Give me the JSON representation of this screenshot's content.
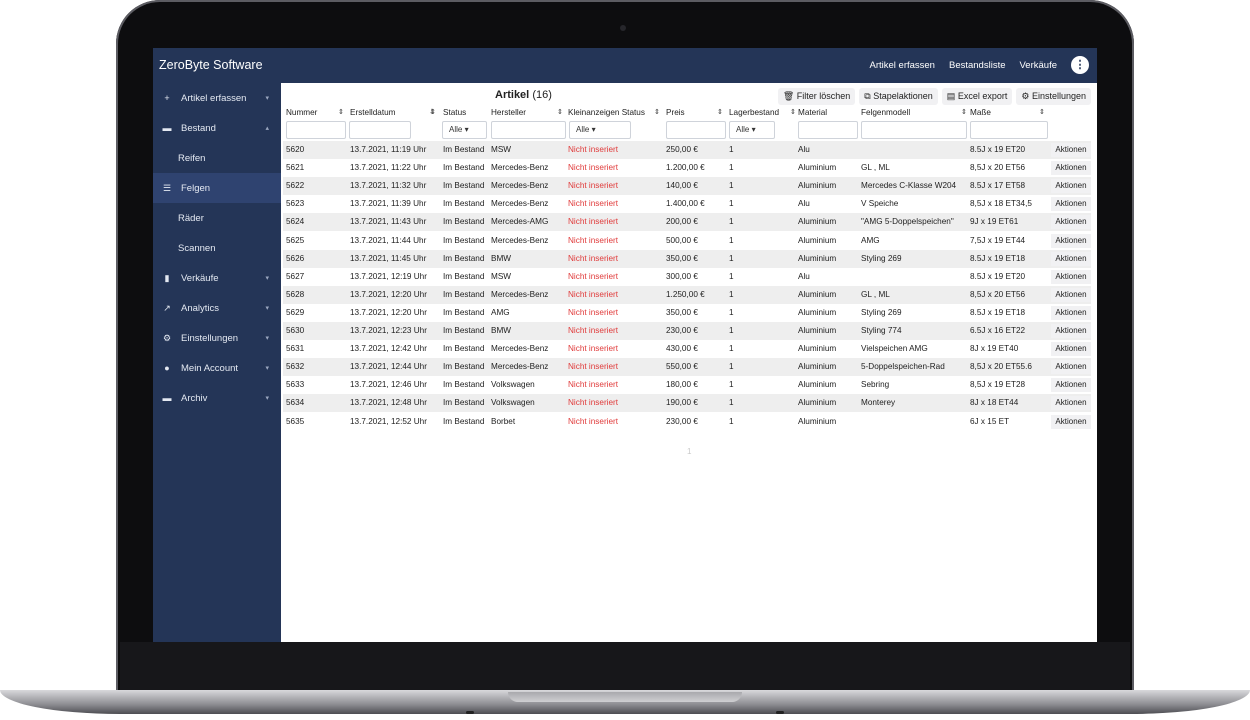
{
  "app": {
    "title": "ZeroByte Software"
  },
  "topnav": {
    "items": [
      "Artikel erfassen",
      "Bestandsliste",
      "Verkäufe"
    ],
    "menu_icon": "more-vertical-icon"
  },
  "sidebar": {
    "items": [
      {
        "label": "Artikel erfassen",
        "icon": "plus-icon"
      },
      {
        "label": "Bestand",
        "icon": "archive-icon"
      },
      {
        "label": "Reifen"
      },
      {
        "label": "Felgen",
        "icon": "list-icon",
        "active": true
      },
      {
        "label": "Räder"
      },
      {
        "label": "Scannen"
      },
      {
        "label": "Verkäufe",
        "icon": "document-icon"
      },
      {
        "label": "Analytics",
        "icon": "chart-icon"
      },
      {
        "label": "Einstellungen",
        "icon": "gears-icon"
      },
      {
        "label": "Mein Account",
        "icon": "user-icon"
      },
      {
        "label": "Archiv",
        "icon": "archive-box-icon"
      }
    ]
  },
  "main": {
    "title": "Artikel",
    "count": "(16)",
    "toolbar": [
      "Filter löschen",
      "Stapelaktionen",
      "Excel export",
      "Einstellungen"
    ],
    "columns": [
      "Nummer",
      "Erstelldatum",
      "Status",
      "Hersteller",
      "Kleinanzeigen Status",
      "Preis",
      "Lagerbestand",
      "Material",
      "Felgenmodell",
      "Maße"
    ],
    "filter_select_label": "Alle",
    "action_label": "Aktionen",
    "pagination": "1",
    "rows": [
      [
        "5620",
        "13.7.2021, 11:19 Uhr",
        "Im Bestand",
        "MSW",
        "Nicht inseriert",
        "250,00 €",
        "1",
        "Alu",
        "",
        "8.5J x 19 ET20"
      ],
      [
        "5621",
        "13.7.2021, 11:22 Uhr",
        "Im Bestand",
        "Mercedes-Benz",
        "Nicht inseriert",
        "1.200,00 €",
        "1",
        "Aluminium",
        "GL , ML",
        "8,5J x 20 ET56"
      ],
      [
        "5622",
        "13.7.2021, 11:32 Uhr",
        "Im Bestand",
        "Mercedes-Benz",
        "Nicht inseriert",
        "140,00 €",
        "1",
        "Aluminium",
        "Mercedes C-Klasse W204",
        "8.5J x 17 ET58"
      ],
      [
        "5623",
        "13.7.2021, 11:39 Uhr",
        "Im Bestand",
        "Mercedes-Benz",
        "Nicht inseriert",
        "1.400,00 €",
        "1",
        "Alu",
        "V Speiche",
        "8,5J x 18 ET34,5"
      ],
      [
        "5624",
        "13.7.2021, 11:43 Uhr",
        "Im Bestand",
        "Mercedes-AMG",
        "Nicht inseriert",
        "200,00 €",
        "1",
        "Aluminium",
        "\"AMG 5-Doppelspeichen\"",
        "9J x 19 ET61"
      ],
      [
        "5625",
        "13.7.2021, 11:44 Uhr",
        "Im Bestand",
        "Mercedes-Benz",
        "Nicht inseriert",
        "500,00 €",
        "1",
        "Aluminium",
        "AMG",
        "7,5J x 19 ET44"
      ],
      [
        "5626",
        "13.7.2021, 11:45 Uhr",
        "Im Bestand",
        "BMW",
        "Nicht inseriert",
        "350,00 €",
        "1",
        "Aluminium",
        "Styling 269",
        "8.5J x 19 ET18"
      ],
      [
        "5627",
        "13.7.2021, 12:19 Uhr",
        "Im Bestand",
        "MSW",
        "Nicht inseriert",
        "300,00 €",
        "1",
        "Alu",
        "",
        "8.5J x 19 ET20"
      ],
      [
        "5628",
        "13.7.2021, 12:20 Uhr",
        "Im Bestand",
        "Mercedes-Benz",
        "Nicht inseriert",
        "1.250,00 €",
        "1",
        "Aluminium",
        "GL , ML",
        "8,5J x 20 ET56"
      ],
      [
        "5629",
        "13.7.2021, 12:20 Uhr",
        "Im Bestand",
        "AMG",
        "Nicht inseriert",
        "350,00 €",
        "1",
        "Aluminium",
        "Styling 269",
        "8.5J x 19 ET18"
      ],
      [
        "5630",
        "13.7.2021, 12:23 Uhr",
        "Im Bestand",
        "BMW",
        "Nicht inseriert",
        "230,00 €",
        "1",
        "Aluminium",
        "Styling 774",
        "6.5J x 16 ET22"
      ],
      [
        "5631",
        "13.7.2021, 12:42 Uhr",
        "Im Bestand",
        "Mercedes-Benz",
        "Nicht inseriert",
        "430,00 €",
        "1",
        "Aluminium",
        "Vielspeichen AMG",
        "8J x 19 ET40"
      ],
      [
        "5632",
        "13.7.2021, 12:44 Uhr",
        "Im Bestand",
        "Mercedes-Benz",
        "Nicht inseriert",
        "550,00 €",
        "1",
        "Aluminium",
        "5-Doppelspeichen-Rad",
        "8,5J x 20 ET55.6"
      ],
      [
        "5633",
        "13.7.2021, 12:46 Uhr",
        "Im Bestand",
        "Volkswagen",
        "Nicht inseriert",
        "180,00 €",
        "1",
        "Aluminium",
        "Sebring",
        "8,5J x 19 ET28"
      ],
      [
        "5634",
        "13.7.2021, 12:48 Uhr",
        "Im Bestand",
        "Volkswagen",
        "Nicht inseriert",
        "190,00 €",
        "1",
        "Aluminium",
        "Monterey",
        "8J x 18 ET44"
      ],
      [
        "5635",
        "13.7.2021, 12:52 Uhr",
        "Im Bestand",
        "Borbet",
        "Nicht inseriert",
        "230,00 €",
        "1",
        "Aluminium",
        "",
        "6J x 15 ET"
      ]
    ]
  },
  "colors": {
    "sidebar": "#243557",
    "active": "#2f4370",
    "status_red": "#e03a3a"
  }
}
